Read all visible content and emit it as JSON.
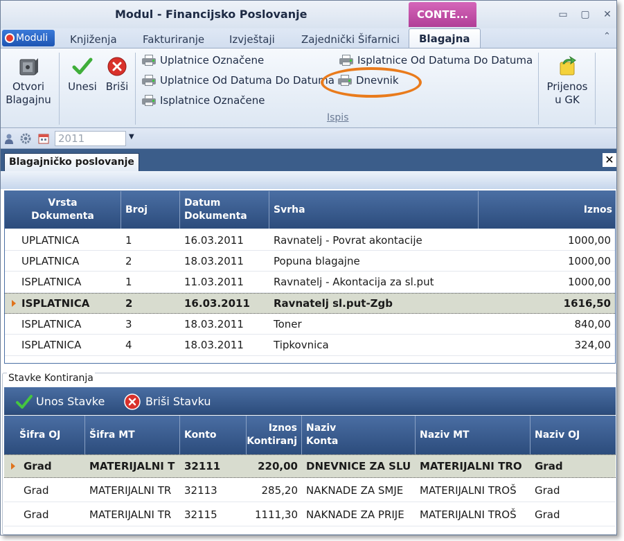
{
  "window": {
    "title": "Modul - Financijsko Poslovanje",
    "context_tab": "CONTE...",
    "controls": {
      "minimize": "▭",
      "restore": "▢",
      "close": "✕"
    }
  },
  "ribbon_tabs": {
    "moduli": "Moduli",
    "items": [
      "Knjiženja",
      "Fakturiranje",
      "Izvještaji",
      "Zajednički Šifarnici",
      "Blagajna"
    ],
    "active": "Blagajna",
    "collapse": "⌃"
  },
  "ribbon": {
    "otvori_line1": "Otvori",
    "otvori_line2": "Blagajnu",
    "unesi": "Unesi",
    "brisi": "Briši",
    "ispis_items": {
      "uplatnice_oznacene": "Uplatnice Označene",
      "uplatnice_od_datuma": "Uplatnice Od Datuma Do Datuma",
      "isplatnice_oznacene": "Isplatnice Označene",
      "isplatnice_od_datuma": "Isplatnice Od Datuma Do Datuma",
      "dnevnik": "Dnevnik"
    },
    "group_label": "Ispis",
    "prijenos_line1": "Prijenos",
    "prijenos_line2": "u GK"
  },
  "toolbar": {
    "year": "2011",
    "dropdown_arrow": "▼"
  },
  "document_tab": {
    "label": "Blagajničko poslovanje",
    "close": "✕"
  },
  "grid1": {
    "columns": {
      "vrsta_line1": "Vrsta",
      "vrsta_line2": "Dokumenta",
      "broj": "Broj",
      "datum_line1": "Datum",
      "datum_line2": "Dokumenta",
      "svrha": "Svrha",
      "iznos": "Iznos"
    },
    "rows": [
      {
        "vrsta": "UPLATNICA",
        "broj": "1",
        "datum": "16.03.2011",
        "svrha": "Ravnatelj - Povrat akontacije",
        "iznos": "1000,00"
      },
      {
        "vrsta": "UPLATNICA",
        "broj": "2",
        "datum": "18.03.2011",
        "svrha": "Popuna blagajne",
        "iznos": "1000,00"
      },
      {
        "vrsta": "ISPLATNICA",
        "broj": "1",
        "datum": "11.03.2011",
        "svrha": "Ravnatelj - Akontacija za sl.put",
        "iznos": "1000,00"
      },
      {
        "vrsta": "ISPLATNICA",
        "broj": "2",
        "datum": "16.03.2011",
        "svrha": "Ravnatelj sl.put-Zgb",
        "iznos": "1616,50"
      },
      {
        "vrsta": "ISPLATNICA",
        "broj": "3",
        "datum": "18.03.2011",
        "svrha": "Toner",
        "iznos": "840,00"
      },
      {
        "vrsta": "ISPLATNICA",
        "broj": "4",
        "datum": "18.03.2011",
        "svrha": "Tipkovnica",
        "iznos": "324,00"
      }
    ]
  },
  "grid2": {
    "legend": "Stavke Kontiranja",
    "unos_stavke": "Unos Stavke",
    "brisi_stavku": "Briši Stavku",
    "columns": {
      "sifra_oj": "Šifra OJ",
      "sifra_mt": "Šifra MT",
      "konto": "Konto",
      "iznos_line1": "Iznos",
      "iznos_line2": "Kontiranj",
      "naziv_konta_line1": "Naziv",
      "naziv_konta_line2": "Konta",
      "naziv_mt": "Naziv MT",
      "naziv_oj": "Naziv OJ"
    },
    "rows": [
      {
        "sifra_oj": "Grad",
        "sifra_mt": "MATERIJALNI T",
        "konto": "32111",
        "iznos": "220,00",
        "naziv_konta": "DNEVNICE ZA SLU",
        "naziv_mt": "MATERIJALNI TRO",
        "naziv_oj": "Grad"
      },
      {
        "sifra_oj": "Grad",
        "sifra_mt": "MATERIJALNI TR",
        "konto": "32113",
        "iznos": "285,20",
        "naziv_konta": "NAKNADE ZA SMJE",
        "naziv_mt": "MATERIJALNI TROŠ",
        "naziv_oj": "Grad"
      },
      {
        "sifra_oj": "Grad",
        "sifra_mt": "MATERIJALNI TR",
        "konto": "32115",
        "iznos": "1111,30",
        "naziv_konta": "NAKNADE ZA PRIJE",
        "naziv_mt": "MATERIJALNI TROŠ",
        "naziv_oj": "Grad"
      }
    ]
  },
  "colors": {
    "accent_blue": "#2c4c7c",
    "context_pink": "#b13e97",
    "highlight_orange": "#e97b1c",
    "selected_row": "#d8dccf"
  }
}
